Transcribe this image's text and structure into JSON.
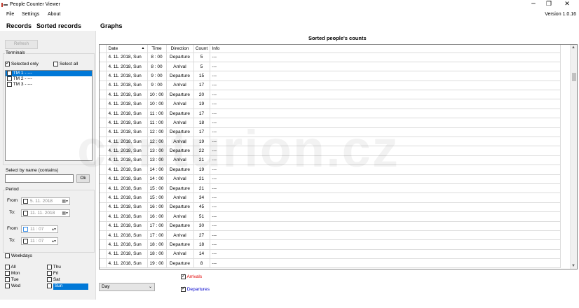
{
  "window": {
    "title": "People Counter Viewer",
    "version": "Version 1.0.16",
    "minimize": "─",
    "maximize": "❐",
    "close": "✕"
  },
  "menu": [
    "File",
    "Settings",
    "About"
  ],
  "tabs": [
    "Records",
    "Sorted records",
    "Graphs"
  ],
  "left": {
    "refresh": "Refresh",
    "terminals_label": "Terminals",
    "selected_only": "Selected only",
    "select_all": "Select all",
    "terminals": [
      "TM 1 - ---",
      "TM 2 - ---",
      "TM 3 - ---"
    ],
    "select_by_name_label": "Select by name (contains)",
    "ok": "Ok",
    "period_label": "Period",
    "from_label": "From",
    "to_label": "To:",
    "from_date": "5. 11. 2018",
    "to_date": "11. 11. 2018",
    "from_time": "11 : 07",
    "to_time": "11 : 07",
    "weekdays_label": "Weekdays",
    "days_col1": [
      "All",
      "Mon",
      "Tue",
      "Wed"
    ],
    "days_col2": [
      "Thu",
      "Fri",
      "Sat",
      "Sun"
    ]
  },
  "main": {
    "title": "Sorted people's counts",
    "columns": [
      "Date",
      "Time",
      "Direction",
      "Count",
      "Info"
    ],
    "rows": [
      [
        "4. 11. 2018,  Sun",
        "8 : 00",
        "Departure",
        "5",
        "---"
      ],
      [
        "4. 11. 2018,  Sun",
        "8 : 00",
        "Arrival",
        "5",
        "---"
      ],
      [
        "4. 11. 2018,  Sun",
        "9 : 00",
        "Departure",
        "15",
        "---"
      ],
      [
        "4. 11. 2018,  Sun",
        "9 : 00",
        "Arrival",
        "17",
        "---"
      ],
      [
        "4. 11. 2018,  Sun",
        "10 : 00",
        "Departure",
        "20",
        "---"
      ],
      [
        "4. 11. 2018,  Sun",
        "10 : 00",
        "Arrival",
        "19",
        "---"
      ],
      [
        "4. 11. 2018,  Sun",
        "11 : 00",
        "Departure",
        "17",
        "---"
      ],
      [
        "4. 11. 2018,  Sun",
        "11 : 00",
        "Arrival",
        "18",
        "---"
      ],
      [
        "4. 11. 2018,  Sun",
        "12 : 00",
        "Departure",
        "17",
        "---"
      ],
      [
        "4. 11. 2018,  Sun",
        "12 : 00",
        "Arrival",
        "19",
        "---"
      ],
      [
        "4. 11. 2018,  Sun",
        "13 : 00",
        "Departure",
        "22",
        "---"
      ],
      [
        "4. 11. 2018,  Sun",
        "13 : 00",
        "Arrival",
        "21",
        "---"
      ],
      [
        "4. 11. 2018,  Sun",
        "14 : 00",
        "Departure",
        "19",
        "---"
      ],
      [
        "4. 11. 2018,  Sun",
        "14 : 00",
        "Arrival",
        "21",
        "---"
      ],
      [
        "4. 11. 2018,  Sun",
        "15 : 00",
        "Departure",
        "21",
        "---"
      ],
      [
        "4. 11. 2018,  Sun",
        "15 : 00",
        "Arrival",
        "34",
        "---"
      ],
      [
        "4. 11. 2018,  Sun",
        "16 : 00",
        "Departure",
        "45",
        "---"
      ],
      [
        "4. 11. 2018,  Sun",
        "16 : 00",
        "Arrival",
        "51",
        "---"
      ],
      [
        "4. 11. 2018,  Sun",
        "17 : 00",
        "Departure",
        "30",
        "---"
      ],
      [
        "4. 11. 2018,  Sun",
        "17 : 00",
        "Arrival",
        "27",
        "---"
      ],
      [
        "4. 11. 2018,  Sun",
        "18 : 00",
        "Departure",
        "18",
        "---"
      ],
      [
        "4. 11. 2018,  Sun",
        "18 : 00",
        "Arrival",
        "14",
        "---"
      ],
      [
        "4. 11. 2018,  Sun",
        "19 : 00",
        "Departure",
        "8",
        "---"
      ]
    ]
  },
  "bottom": {
    "combo_value": "Day",
    "arrivals": "Arrivals",
    "departures": "Departures",
    "arrivals_color": "#e00000",
    "departures_color": "#0000cc"
  },
  "watermark": "centurion.cz"
}
